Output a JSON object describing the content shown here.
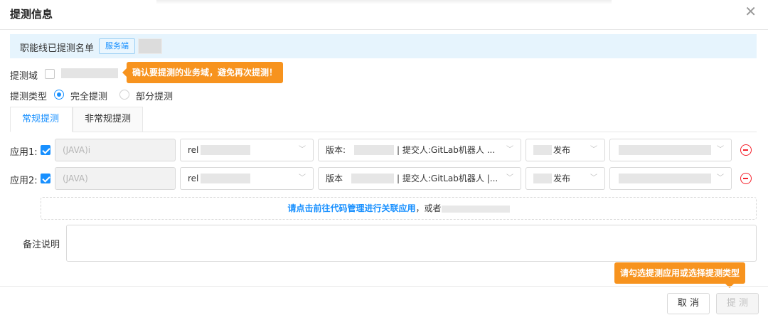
{
  "dialog": {
    "title": "提测信息"
  },
  "banner": {
    "label": "职能线已提测名单",
    "tag": "服务端"
  },
  "domain": {
    "label": "提测域",
    "tooltip": "确认要提测的业务域，避免再次提测！"
  },
  "test_type": {
    "label": "提测类型",
    "options": [
      "完全提测",
      "部分提测"
    ],
    "selected": "完全提测"
  },
  "tabs": [
    {
      "label": "常规提测"
    },
    {
      "label": "非常规提测"
    }
  ],
  "apps": [
    {
      "label": "应用1:",
      "app": "(JAVA)i",
      "branch": "rel",
      "version": "版本:",
      "committer": "| 提交人:GitLab机器人 ...",
      "action": "发布"
    },
    {
      "label": "应用2:",
      "app": "(JAVA)",
      "branch": "rel",
      "version": "版本",
      "committer": "| 提交人:GitLab机器人 |...",
      "action": "发布"
    }
  ],
  "link": {
    "text": "请点击前往代码管理进行关联应用",
    "suffix": "，或者"
  },
  "remark": {
    "label": "备注说明",
    "value": ""
  },
  "footer": {
    "tooltip": "请勾选提测应用或选择提测类型",
    "cancel": "取 消",
    "submit": "提 测"
  }
}
